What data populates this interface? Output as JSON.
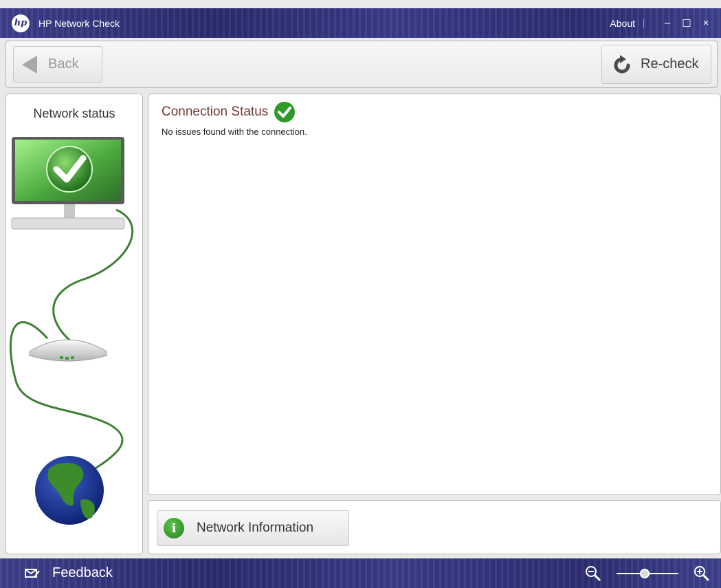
{
  "window": {
    "title": "HP Network Check",
    "about_label": "About",
    "minimize_glyph": "–",
    "maximize_glyph": "☐",
    "close_glyph": "×"
  },
  "toolbar": {
    "back_label": "Back",
    "recheck_label": "Re-check"
  },
  "sidebar": {
    "title": "Network status",
    "icons": [
      "monitor-check-icon",
      "router-icon",
      "globe-icon"
    ]
  },
  "main": {
    "heading": "Connection Status",
    "status_icon": "green-check-icon",
    "message": "No issues found with the connection."
  },
  "bottom": {
    "network_info_label": "Network Information"
  },
  "statusbar": {
    "feedback_label": "Feedback",
    "zoom_level": 0.45
  },
  "colors": {
    "titlebar": "#2c2e74",
    "heading": "#74363a",
    "success": "#2f9a2a"
  }
}
